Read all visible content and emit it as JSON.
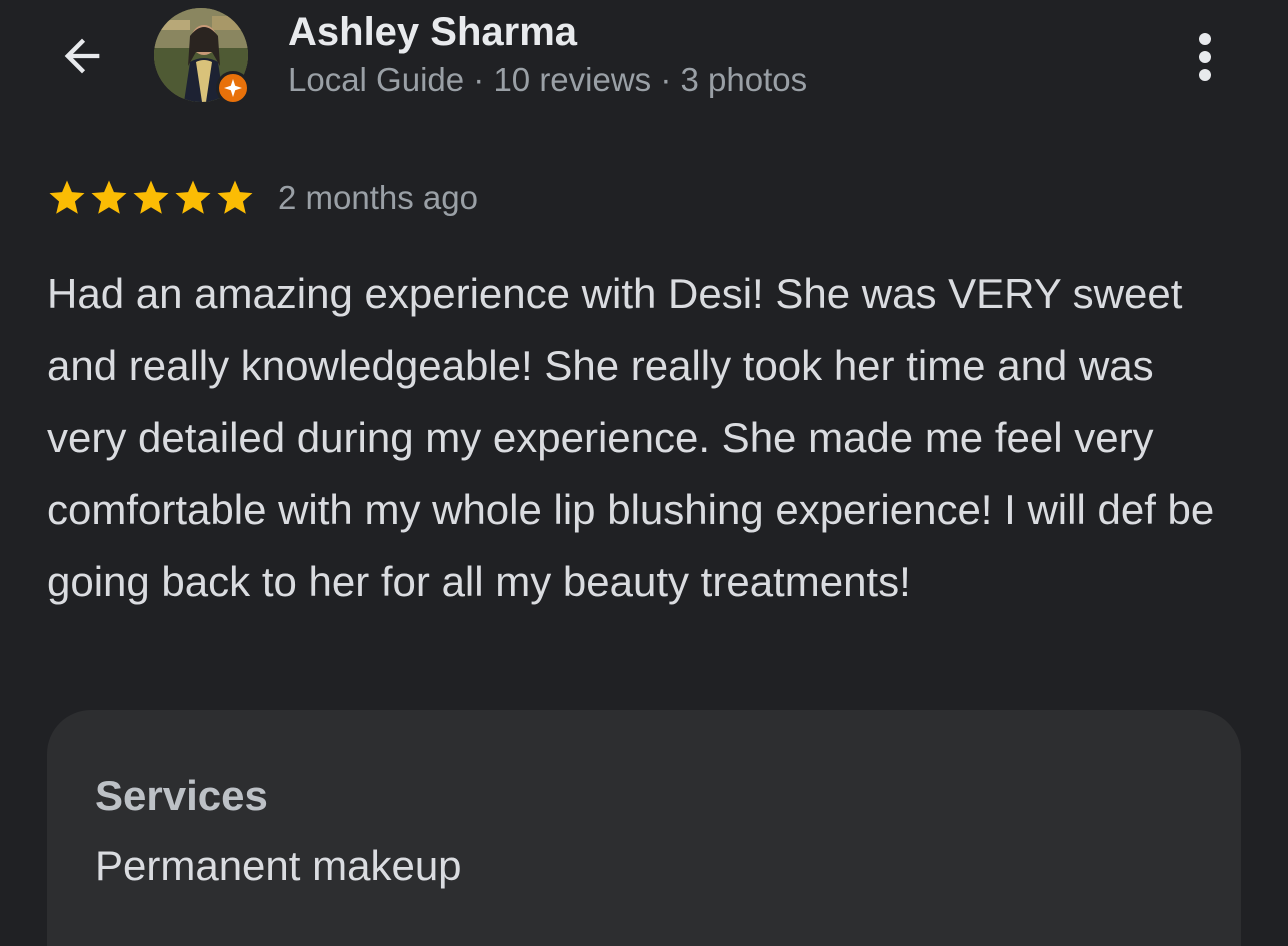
{
  "header": {
    "back_icon": "arrow-back-icon",
    "more_icon": "more-vert-icon"
  },
  "reviewer": {
    "name": "Ashley Sharma",
    "meta": "Local Guide · 10 reviews · 3 photos",
    "badge_icon": "local-guide-star-icon",
    "badge_color": "#e8710a"
  },
  "review": {
    "rating": 5,
    "max_rating": 5,
    "star_color": "#fbbc04",
    "time": "2 months ago",
    "text": "Had an amazing experience with Desi! She was VERY sweet and really knowledgeable! She really took her time and was very detailed during my experience. She made me feel very comfortable with my whole lip blushing experience! I will def be going back to her for all my beauty treatments!"
  },
  "services": {
    "title": "Services",
    "value": "Permanent makeup"
  },
  "colors": {
    "background": "#202124",
    "card": "#2d2e30",
    "primary_text": "#e8eaed",
    "secondary_text": "#9aa0a6"
  }
}
